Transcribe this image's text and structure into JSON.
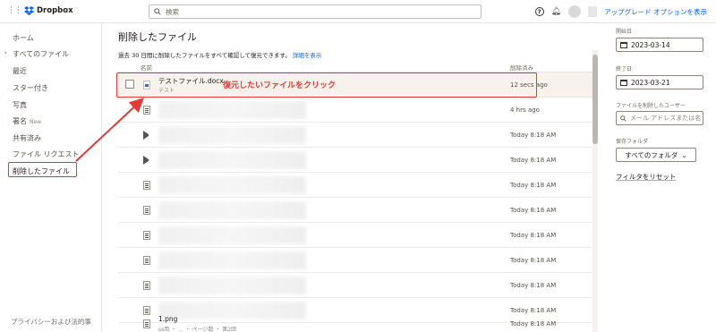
{
  "header": {
    "app_name": "Dropbox",
    "search_placeholder": "検索",
    "help_label": "?",
    "upgrade_label": "アップグレード オプションを表示"
  },
  "sidebar": {
    "items": [
      {
        "label": "ホーム"
      },
      {
        "label": "すべてのファイル",
        "expandable": true
      },
      {
        "label": "最近"
      },
      {
        "label": "スター付き"
      },
      {
        "label": "写真"
      },
      {
        "label": "署名",
        "badge": "New"
      },
      {
        "label": "共有済み"
      },
      {
        "label": "ファイル リクエスト"
      },
      {
        "label": "削除したファイル",
        "active": true
      }
    ],
    "footer": "プライバシーおよび法的事"
  },
  "main": {
    "title": "削除したファイル",
    "subtitle": "過去 30 日間に削除したファイルをすべて確認して復元できます。",
    "subtitle_link": "詳細を表示",
    "col_name": "名前",
    "col_deleted": "削除済み",
    "annotation": "復元したいファイルをクリック",
    "rows": [
      {
        "icon": "doc-icon",
        "name": "テストファイル.docx",
        "sub": "テスト",
        "time": "12 secs ago",
        "checkbox": true
      },
      {
        "icon": "file-icon",
        "time": "4 hrs ago"
      },
      {
        "icon": "video-icon",
        "time": "Today 8:18 AM"
      },
      {
        "icon": "video-icon",
        "time": "Today 8:18 AM"
      },
      {
        "icon": "file-icon",
        "time": "Today 8:18 AM"
      },
      {
        "icon": "file-icon",
        "time": "Today 8:18 AM"
      },
      {
        "icon": "file-icon",
        "time": "Today 8:18 AM"
      },
      {
        "icon": "file-icon",
        "time": "Today 8:18 AM"
      },
      {
        "icon": "file-icon",
        "time": "Today 8:18 AM"
      },
      {
        "icon": "file-icon",
        "time": "Today 8:18 AM"
      },
      {
        "icon": "file-icon",
        "name": "1.png",
        "sub": "ss用 ・ ... ・ ページ数 ・ 第2回",
        "time": "Today 8:18 AM"
      }
    ]
  },
  "filters": {
    "start_label": "開始日",
    "start_value": "2023-03-14",
    "end_label": "終了日",
    "end_value": "2023-03-21",
    "user_label": "ファイルを削除したユーザー",
    "user_placeholder": "メール アドレスまたは名",
    "folder_label": "保存フォルダ",
    "folder_value": "すべてのフォルダ",
    "reset_label": "フィルタをリセット"
  },
  "colors": {
    "accent": "#0061fe",
    "highlight": "#e53935"
  }
}
